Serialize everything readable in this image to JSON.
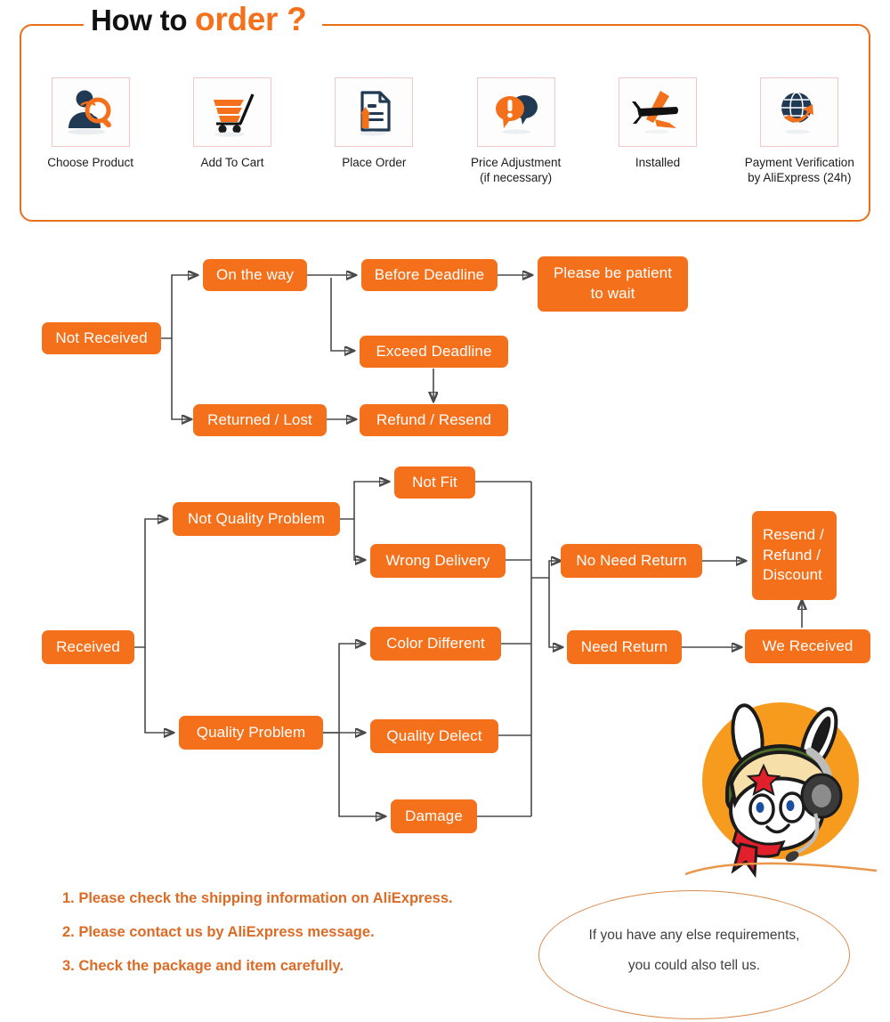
{
  "header": {
    "title_black": "How to ",
    "title_orange": "order ?",
    "accent_color": "#F4701B",
    "border_color": "#E8701A",
    "steps": [
      {
        "label": "Choose Product",
        "icon": "user-search-icon"
      },
      {
        "label": "Add To Cart",
        "icon": "shopping-cart-icon"
      },
      {
        "label": "Place Order",
        "icon": "document-upload-icon"
      },
      {
        "label": "Price Adjustment\n(if necessary)",
        "icon": "chat-alert-icon"
      },
      {
        "label": "Installed",
        "icon": "airplane-icon"
      },
      {
        "label": "Payment Verification\nby AliExpress (24h)",
        "icon": "globe-arrow-icon"
      }
    ]
  },
  "flow_not_received": {
    "nodes": {
      "not_received": "Not Received",
      "on_the_way": "On the way",
      "before_deadline": "Before Deadline",
      "please_be_patient": "Please be patient\nto wait",
      "exceed_deadline": "Exceed Deadline",
      "returned_lost": "Returned / Lost",
      "refund_resend": "Refund / Resend"
    }
  },
  "flow_received": {
    "nodes": {
      "received": "Received",
      "not_quality_problem": "Not Quality Problem",
      "quality_problem": "Quality Problem",
      "not_fit": "Not Fit",
      "wrong_delivery": "Wrong Delivery",
      "color_different": "Color Different",
      "quality_delect": "Quality Delect",
      "damage": "Damage",
      "no_need_return": "No Need Return",
      "need_return": "Need Return",
      "resend_refund_discount": "Resend /\nRefund /\nDiscount",
      "we_received": "We Received"
    }
  },
  "notes": {
    "items": [
      "1. Please check the shipping information on AliExpress.",
      "2. Please contact us by AliExpress message.",
      "3. Check the package and item carefully."
    ],
    "color": "#DC6B26"
  },
  "bubble": {
    "line1": "If you have any else requirements,",
    "line2": "you could also tell us.",
    "border_color": "#D98A4E"
  }
}
